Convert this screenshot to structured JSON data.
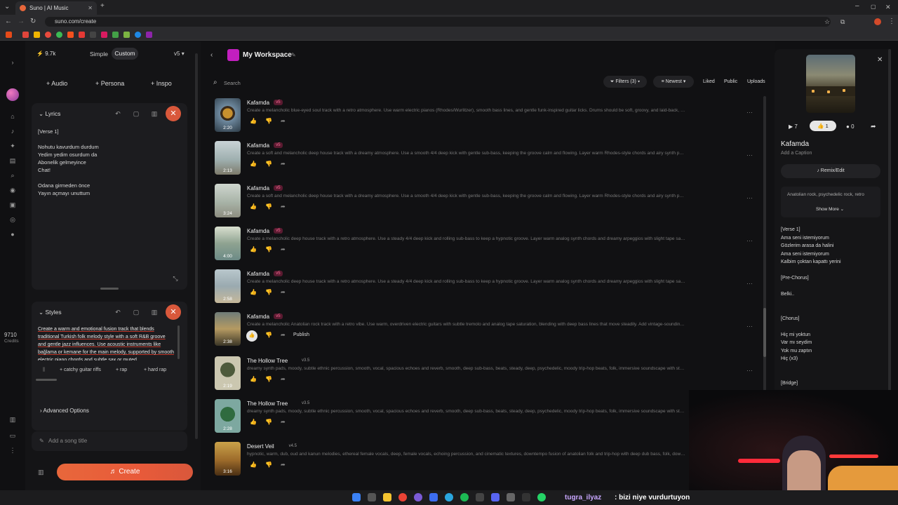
{
  "browser": {
    "tab_title": "Suno | AI Music",
    "url": "suno.com/create"
  },
  "top": {
    "credits_badge": "9.7k",
    "mode_simple": "Simple",
    "mode_custom": "Custom",
    "version": "v5"
  },
  "left": {
    "audio": "Audio",
    "persona": "Persona",
    "inspo": "Inspo",
    "lyrics_title": "Lyrics",
    "lyrics_lines": [
      "[Verse 1]",
      "Nohutu kavurdum durdum",
      "Yedim yedim osurdum da",
      "Abonelik gelmeyince",
      "Chat!",
      "Odana girmeden önce",
      "Yayın açmayı unuttum"
    ],
    "styles_title": "Styles",
    "styles_text": "Create a warm and emotional fusion track that blends traditional Turkish folk melody style with a soft R&B groove and gentle jazz influences. Use acoustic instruments like bağlama or kemane for the main melody, supported by smooth electric piano chords and subtle sax or muted",
    "chips": [
      "catchy guitar riffs",
      "rap",
      "hard rap"
    ],
    "advanced": "Advanced Options",
    "song_title_placeholder": "Add a song title",
    "create": "Create",
    "credits_count": "9710",
    "credits_label": "Credits"
  },
  "main": {
    "workspace": "My Workspace",
    "search_placeholder": "Search",
    "filters": "Filters (3)",
    "sort": "Newest",
    "liked": "Liked",
    "public": "Public",
    "uploads": "Uploads",
    "publish": "Publish",
    "songs": [
      {
        "title": "Kafamda",
        "version": "v5",
        "duration": "2:20",
        "desc": "Create a melancholic blue-eyed soul track with a retro atmosphere. Use warm electric pianos (Rhodes/Wurlitzer), smooth bass lines, and gentle funk-inspired guitar licks. Drums should be soft, groovy, and laid-back, with vint"
      },
      {
        "title": "Kafamda",
        "version": "v5",
        "duration": "2:13",
        "desc": "Create a soft and melancholic deep house track with a dreamy atmosphere. Use a smooth 4/4 deep kick with gentle sub-bass, keeping the groove calm and flowing. Layer warm Rhodes-style chords and airy synth pads to c"
      },
      {
        "title": "Kafamda",
        "version": "v5",
        "duration": "3:24",
        "desc": "Create a soft and melancholic deep house track with a dreamy atmosphere. Use a smooth 4/4 deep kick with gentle sub-bass, keeping the groove calm and flowing. Layer warm Rhodes-style chords and airy synth pads to c"
      },
      {
        "title": "Kafamda",
        "version": "v5",
        "duration": "4:00",
        "desc": "Create a melancholic deep house track with a retro atmosphere. Use a steady 4/4 deep kick and rolling sub-bass to keep a hypnotic groove. Layer warm analog synth chords and dreamy arpeggios with slight tape saturation."
      },
      {
        "title": "Kafamda",
        "version": "v5",
        "duration": "2:58",
        "desc": "Create a melancholic deep house track with a retro atmosphere. Use a steady 4/4 deep kick and rolling sub-bass to keep a hypnotic groove. Layer warm analog synth chords and dreamy arpeggios with slight tape saturation."
      },
      {
        "title": "Kafamda",
        "version": "v5",
        "duration": "2:38",
        "desc": "Create a melancholic Anatolian rock track with a retro vibe. Use warm, overdriven electric guitars with subtle tremolo and analog tape saturation, blending with deep bass lines that move steadily. Add vintage-sounding orga"
      },
      {
        "title": "The Hollow Tree",
        "version": "v3.5",
        "duration": "2:19",
        "desc": "dreamy synth pads, moody, subtle ethnic percussion, smooth, vocal, spacious echoes and reverb, smooth, deep sub-bass, beats, steady, deep, psychedelic, moody trip-hop beats, folk, immersive soundscape with steady gro"
      },
      {
        "title": "The Hollow Tree",
        "version": "v3.5",
        "duration": "2:28",
        "desc": "dreamy synth pads, moody, subtle ethnic percussion, smooth, vocal, spacious echoes and reverb, smooth, deep sub-bass, beats, steady, deep, psychedelic, moody trip-hop beats, folk, immersive soundscape with steady gro"
      },
      {
        "title": "Desert Veil",
        "version": "v4.5",
        "duration": "3:16",
        "desc": "hypnotic, warm, dub, oud and kanun melodies, ethereal female vocals, deep, female vocals, echoing percussion, and cinematic textures, downtempo fusion of anatolian folk and trip-hop with deep dub bass, folk, downtempo f"
      }
    ]
  },
  "right": {
    "plays": "7",
    "likes": "1",
    "comments": "0",
    "title": "Kafamda",
    "caption": "Add a Caption",
    "remix": "Remix/Edit",
    "style_tags": "Anatolian rock, psychedelic rock, retro",
    "show_more": "Show More",
    "lyrics": [
      "[Verse 1]",
      "Ama seni istemiyorum",
      "Gözlerim arasa da halini",
      "Ama seni istemiyorum",
      "Kalbim çoktan kapattı yerini",
      "",
      "[Pre-Chorus]",
      "",
      "Belki..",
      "",
      "",
      "[Chorus]",
      "",
      "Hiç mi yoktun",
      "Var mı seydim",
      "Yok mu zaptın",
      "Hiç (x3)",
      "",
      "",
      "[Bridge]"
    ]
  },
  "stream": {
    "chat_user": "tugra_ilyaz",
    "chat_msg": ": bizi niye vurdurtuyon"
  },
  "colors": {
    "accent": "#d9583b",
    "workspace_icon": "#c21fbf",
    "version_badge": "#e0457a"
  }
}
